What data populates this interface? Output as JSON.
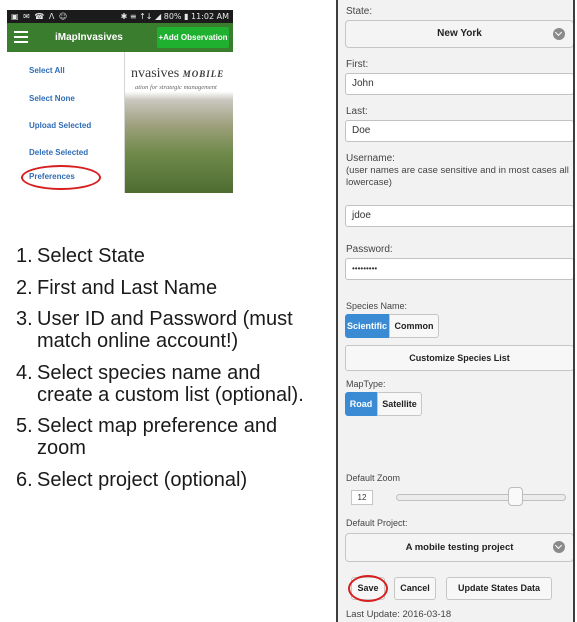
{
  "phone": {
    "status_left": "▣ ✉ ☎ Ʌ ☺",
    "status_right": "✱ ≡ ↑↓ ◢ 80% ▮ 11:02 AM",
    "app_title": "iMapInvasives",
    "add_button": "+Add Observation",
    "logo_text": "nvasives",
    "logo_mobile": "MOBILE",
    "logo_tagline": "ation for strategic management",
    "menu_items": [
      "Select All",
      "Select None",
      "Upload Selected",
      "Delete Selected",
      "Preferences"
    ],
    "colors": {
      "app_bar": "#3b7d2e",
      "add_button": "#20b030",
      "menu_text": "#2f6db5",
      "highlight": "#d81f1f"
    }
  },
  "steps": [
    {
      "num": "1.",
      "text": "Select State"
    },
    {
      "num": "2.",
      "text": "First and Last Name"
    },
    {
      "num": "3.",
      "text": "User ID and Password (must match online account!)"
    },
    {
      "num": "4.",
      "text": "Select species name and create a custom list (optional)."
    },
    {
      "num": "5.",
      "text": "Select map preference and zoom"
    },
    {
      "num": "6.",
      "text": "Select project (optional)"
    }
  ],
  "settings": {
    "state_label": "State:",
    "state_value": "New York",
    "first_label": "First:",
    "first_value": "John",
    "last_label": "Last:",
    "last_value": "Doe",
    "username_label": "Username:",
    "username_note": "(user names are case sensitive and in most cases all lowercase)",
    "username_value": "jdoe",
    "password_label": "Password:",
    "password_value": "•••••••••",
    "species_label": "Species Name:",
    "species_options": [
      "Scientific",
      "Common"
    ],
    "species_selected": "Scientific",
    "customize_label": "Customize Species List",
    "maptype_label": "MapType:",
    "maptype_options": [
      "Road",
      "Satellite"
    ],
    "maptype_selected": "Road",
    "zoom_label": "Default Zoom",
    "zoom_value": "12",
    "zoom_level_fraction": 0.72,
    "project_label": "Default Project:",
    "project_value": "A mobile testing project",
    "save_label": "Save",
    "cancel_label": "Cancel",
    "update_label": "Update States Data",
    "last_update": "Last Update: 2016-03-18",
    "colors": {
      "active_segment": "#3b8bd4",
      "highlight": "#d81f1f"
    }
  }
}
